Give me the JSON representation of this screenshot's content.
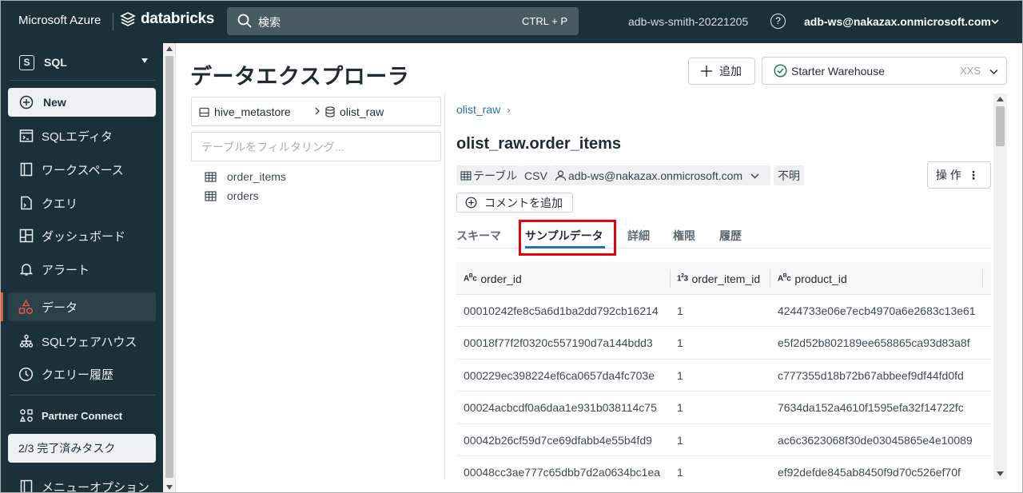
{
  "topbar": {
    "brand_microsoft": "Microsoft Azure",
    "brand_databricks": "databricks",
    "search_label": "検索",
    "search_shortcut": "CTRL + P",
    "workspace_name": "adb-ws-smith-20221205",
    "help_glyph": "?",
    "user_email": "adb-ws@nakazax.onmicrosoft.com"
  },
  "sidebar": {
    "persona_letter": "S",
    "persona_label": "SQL",
    "new_label": "New",
    "items": [
      {
        "label": "SQLエディタ",
        "icon": "sql-editor-icon"
      },
      {
        "label": "ワークスペース",
        "icon": "workspace-icon"
      },
      {
        "label": "クエリ",
        "icon": "query-icon"
      },
      {
        "label": "ダッシュボード",
        "icon": "dashboard-icon"
      },
      {
        "label": "アラート",
        "icon": "alert-bell-icon"
      },
      {
        "label": "データ",
        "icon": "data-icon"
      },
      {
        "label": "SQLウェアハウス",
        "icon": "warehouse-icon"
      },
      {
        "label": "クエリー履歴",
        "icon": "history-clock-icon"
      }
    ],
    "partner_connect": "Partner Connect",
    "tasks_label": "2/3 完了済みタスク",
    "menu_options": "メニューオプション"
  },
  "header": {
    "page_title": "データエクスプローラ",
    "add_label": "追加",
    "warehouse_name": "Starter Warehouse",
    "warehouse_size": "XXS"
  },
  "catalog": {
    "metastore": "hive_metastore",
    "schema": "olist_raw",
    "filter_placeholder": "テーブルをフィルタリング...",
    "tables": [
      "order_items",
      "orders"
    ]
  },
  "detail": {
    "breadcrumb": "olist_raw",
    "breadcrumb_arrow": "›",
    "table_title": "olist_raw.order_items",
    "chip_type": "テーブル",
    "chip_format": "CSV",
    "chip_owner": "adb-ws@nakazax.onmicrosoft.com",
    "chip_unknown": "不明",
    "ops_label": "操 作",
    "ops_dots": "⋮",
    "add_comment": "コメントを追加",
    "tabs": [
      "スキーマ",
      "サンプルデータ",
      "詳細",
      "権限",
      "履歴"
    ],
    "selected_tab": "サンプルデータ"
  },
  "grid": {
    "columns": [
      {
        "name": "order_id",
        "type": "ABC"
      },
      {
        "name": "order_item_id",
        "type": "123"
      },
      {
        "name": "product_id",
        "type": "ABC"
      }
    ],
    "rows": [
      [
        "00010242fe8c5a6d1ba2dd792cb16214",
        "1",
        "4244733e06e7ecb4970a6e2683c13e61"
      ],
      [
        "00018f77f2f0320c557190d7a144bdd3",
        "1",
        "e5f2d52b802189ee658865ca93d83a8f"
      ],
      [
        "000229ec398224ef6ca0657da4fc703e",
        "1",
        "c777355d18b72b67abbeef9df44fd0fd"
      ],
      [
        "00024acbcdf0a6daa1e931b038114c75",
        "1",
        "7634da152a4610f1595efa32f14722fc"
      ],
      [
        "00042b26cf59d7ce69dfabb4e55b4fd9",
        "1",
        "ac6c3623068f30de03045865e4e10089"
      ],
      [
        "00048cc3ae777c65dbb7d2a0634bc1ea",
        "1",
        "ef92defde845ab8450f9d70c526ef70f"
      ]
    ]
  },
  "colors": {
    "topbar_bg": "#1b3139",
    "accent_blue": "#2272b4",
    "active_red": "#e4573f",
    "highlight_red": "#e60012"
  }
}
